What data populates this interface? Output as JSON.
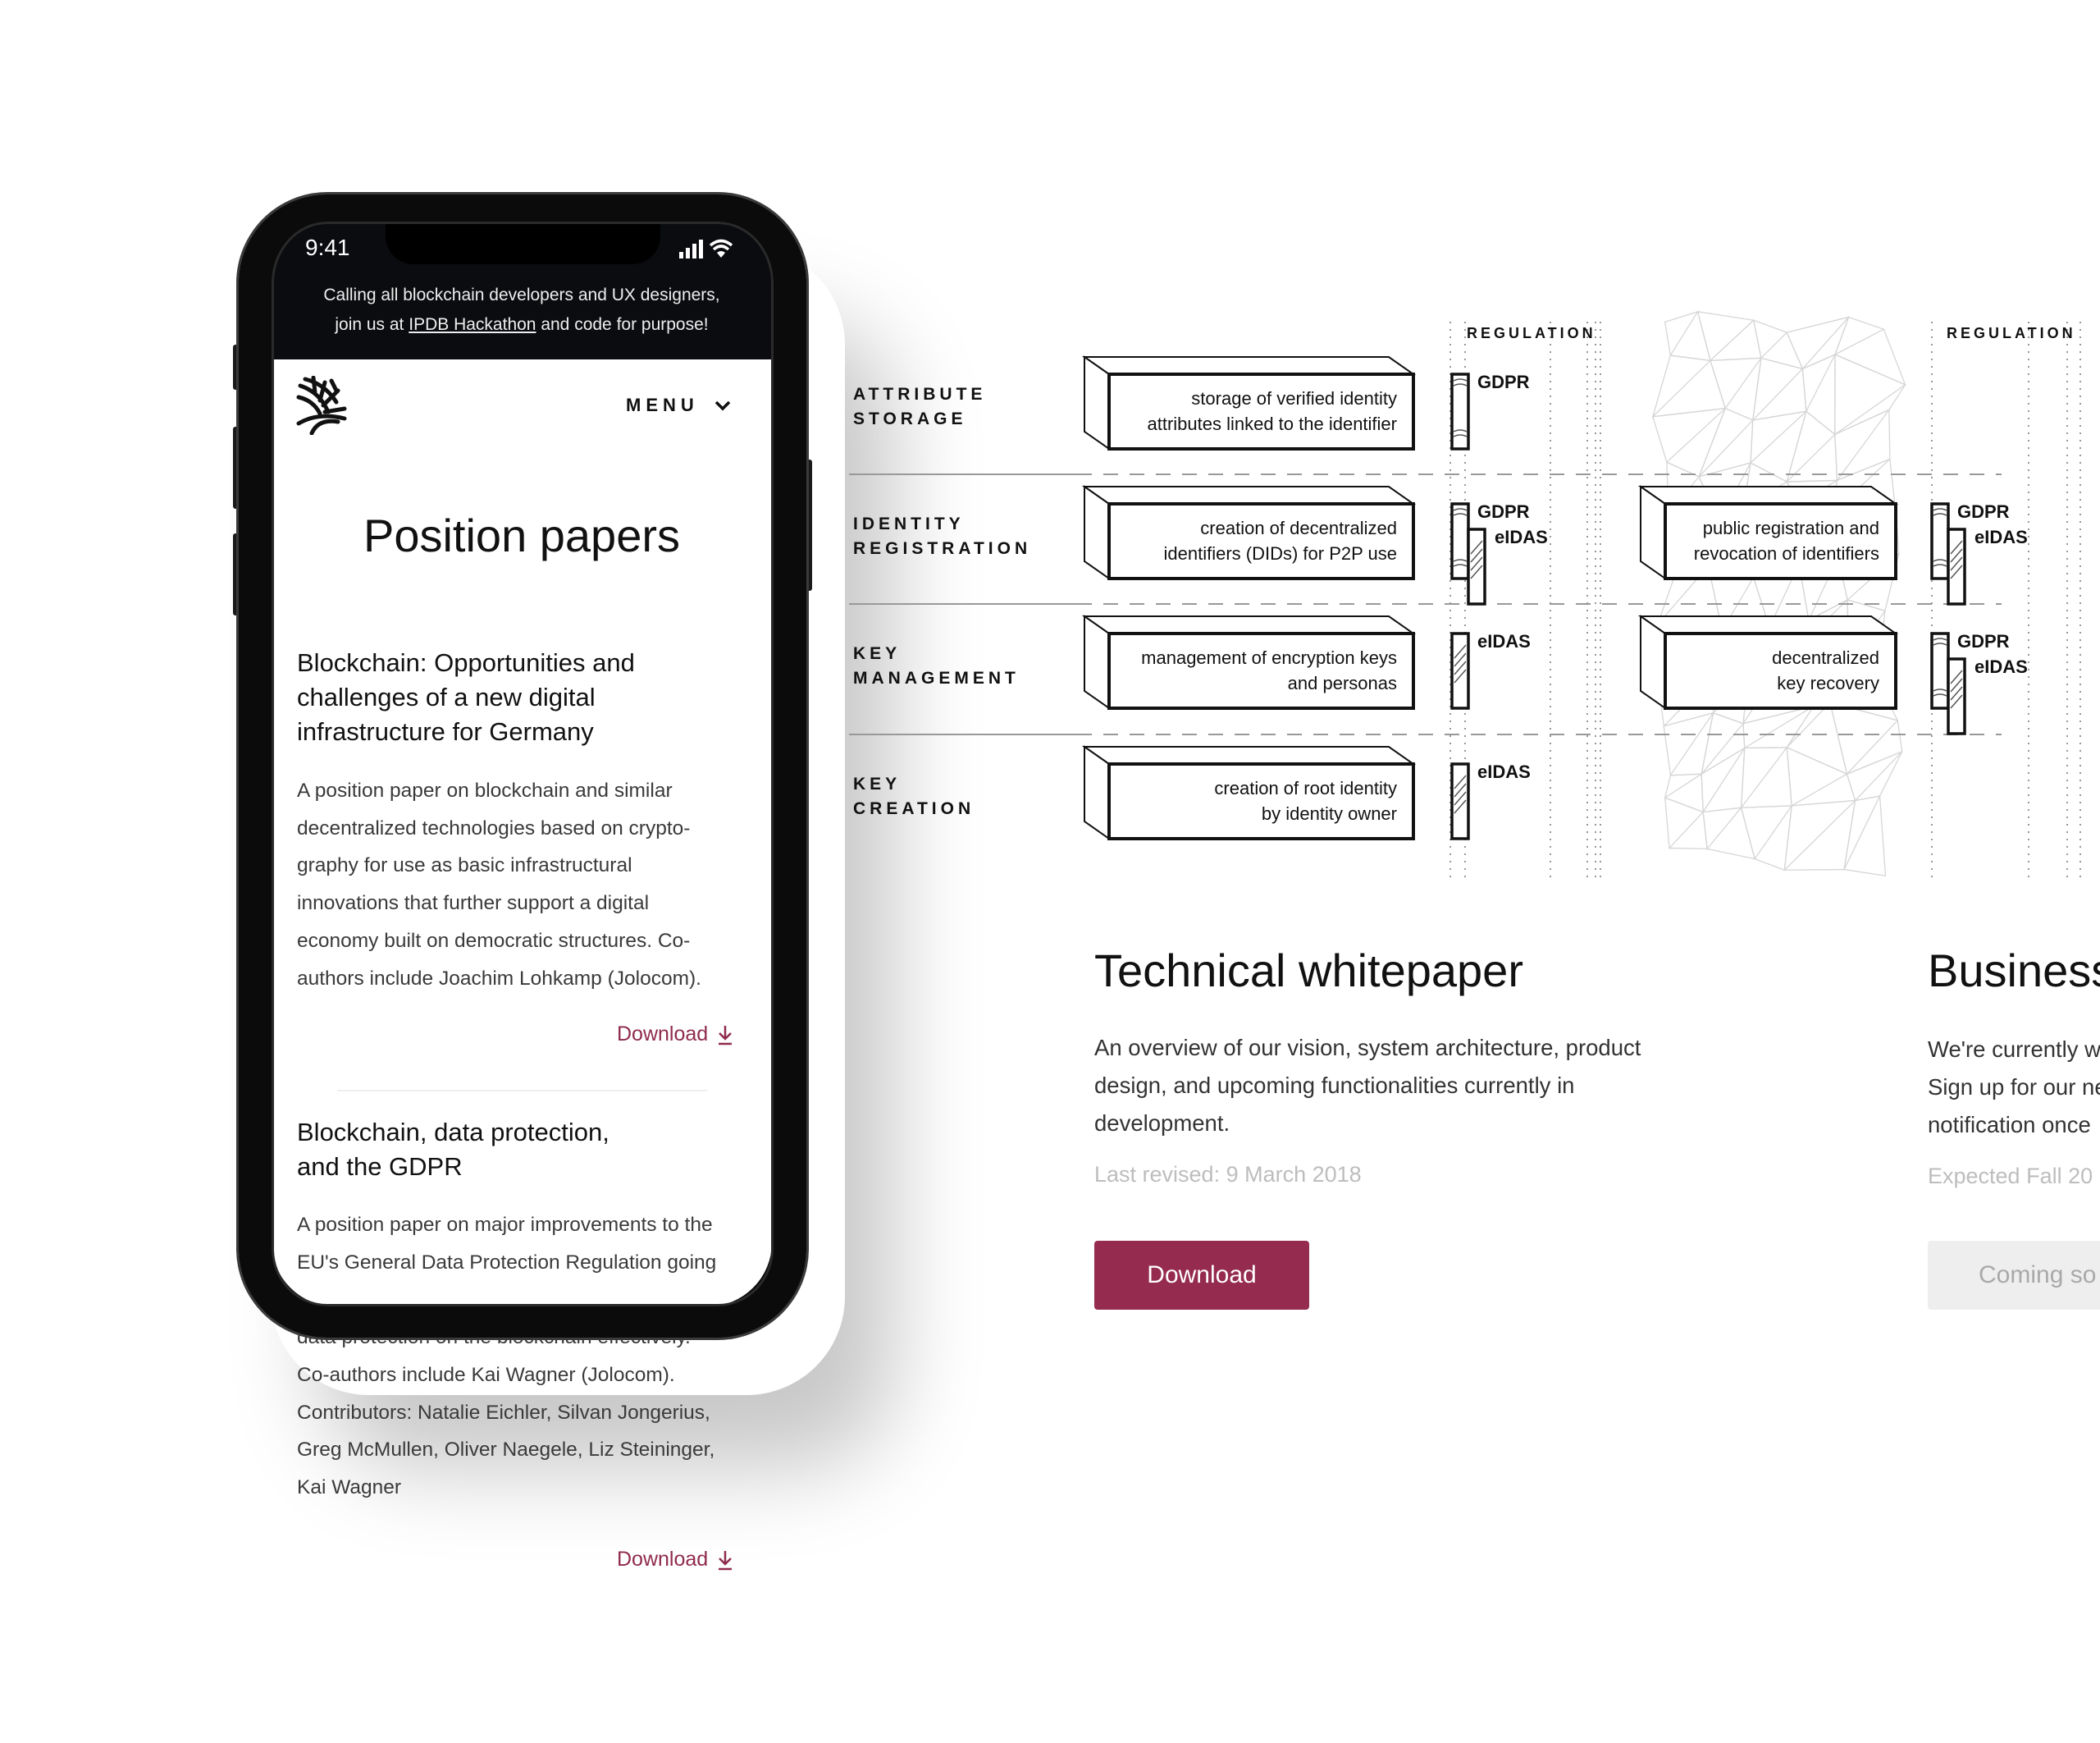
{
  "phone": {
    "status_time": "9:41",
    "banner": {
      "line1": "Calling all blockchain developers and UX designers,",
      "line2_prefix": "join us at ",
      "link": "IPDB Hackathon",
      "line2_suffix": " and code for purpose!"
    },
    "menu_label": "MENU",
    "page_title": "Position papers",
    "articles": [
      {
        "title_lines": [
          "Blockchain: Opportunities and",
          "challenges of a new digital",
          "infrastructure for Germany"
        ],
        "body_lines": [
          "A position paper on blockchain and similar",
          "decentralized technologies based on crypto-",
          "graphy for use as basic infrastructural",
          "innovations that further support a digital",
          "economy built on democratic structures. Co-",
          "authors include Joachim Lohkamp (Jolocom)."
        ],
        "download_label": "Download"
      },
      {
        "title_lines": [
          "Blockchain, data protection,",
          "and the GDPR"
        ],
        "body_lines": [
          "A position paper on major improvements to the",
          "EU's General Data Protection Regulation going",
          "data protection on the blockchain effectively.",
          "Co-authors include Kai Wagner (Jolocom).",
          "Contributors: Natalie Eichler, Silvan Jongerius,",
          "Greg McMullen, Oliver Naegele, Liz Steininger,",
          "Kai Wagner"
        ],
        "download_label": "Download"
      }
    ]
  },
  "diagram": {
    "regulation_header": "REGULATION",
    "rows": [
      {
        "label": [
          "ATTRIBUTE",
          "STORAGE"
        ],
        "box": [
          "storage of verified identity",
          "attributes linked to the identifier"
        ],
        "regs": [
          "GDPR"
        ],
        "box2": null,
        "regs2": []
      },
      {
        "label": [
          "IDENTITY",
          "REGISTRATION"
        ],
        "box": [
          "creation of decentralized",
          "identifiers (DIDs) for P2P use"
        ],
        "regs": [
          "GDPR",
          "eIDAS"
        ],
        "box2": [
          "public registration and",
          "revocation of identifiers"
        ],
        "regs2": [
          "GDPR",
          "eIDAS"
        ]
      },
      {
        "label": [
          "KEY",
          "MANAGEMENT"
        ],
        "box": [
          "management of encryption keys",
          "and personas"
        ],
        "regs": [
          "eIDAS"
        ],
        "box2": [
          "decentralized",
          "key recovery"
        ],
        "regs2": [
          "GDPR",
          "eIDAS"
        ]
      },
      {
        "label": [
          "KEY",
          "CREATION"
        ],
        "box": [
          "creation of root identity",
          "by identity owner"
        ],
        "regs": [
          "eIDAS"
        ],
        "box2": null,
        "regs2": []
      }
    ]
  },
  "technical": {
    "title": "Technical whitepaper",
    "body_lines": [
      "An overview of our vision, system architecture, product",
      "design, and upcoming functionalities currently in",
      "development."
    ],
    "meta": "Last revised: 9 March 2018",
    "button": "Download"
  },
  "business": {
    "title": "Business",
    "body_lines": [
      "We're currently w",
      "Sign up for our ne",
      "notification once"
    ],
    "meta": "Expected Fall 20",
    "button": "Coming so"
  },
  "colors": {
    "accent": "#952b4e",
    "disabled_bg": "#eeeeee",
    "disabled_text": "#a9a9a9",
    "banner_bg": "#0b0c10"
  }
}
